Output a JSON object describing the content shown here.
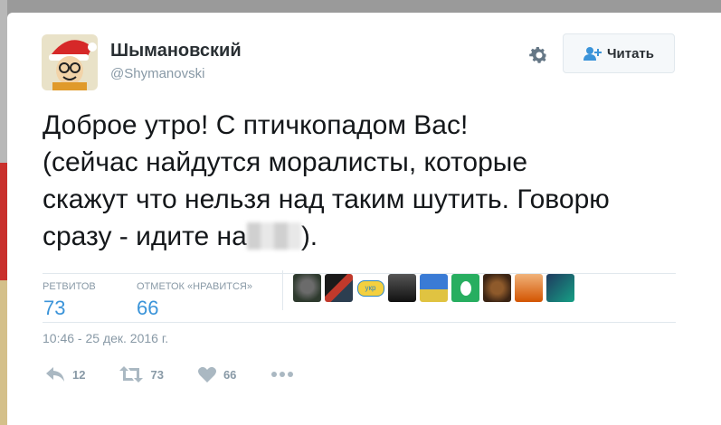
{
  "profile": {
    "name": "Шымановский",
    "handle": "@Shymanovski"
  },
  "follow_button": {
    "label": "Читать"
  },
  "tweet": {
    "line1": "Доброе утро! С птичкопадом Вас!",
    "line2": "(сейчас найдутся моралисты, которые",
    "line3": "скажут что нельзя над таким шутить. Говорю",
    "line4_before": "сразу - идите на",
    "line4_after": ")."
  },
  "stats": {
    "retweets_label": "РЕТВИТОВ",
    "retweets_value": "73",
    "likes_label": "ОТМЕТОК «НРАВИТСЯ»",
    "likes_value": "66"
  },
  "timestamp": "10:46 - 25 дек. 2016 г.",
  "actions": {
    "reply_count": "12",
    "retweet_count": "73",
    "like_count": "66"
  },
  "colors": {
    "accent": "#3b94d9",
    "muted": "#8899a6",
    "text": "#14171a"
  }
}
